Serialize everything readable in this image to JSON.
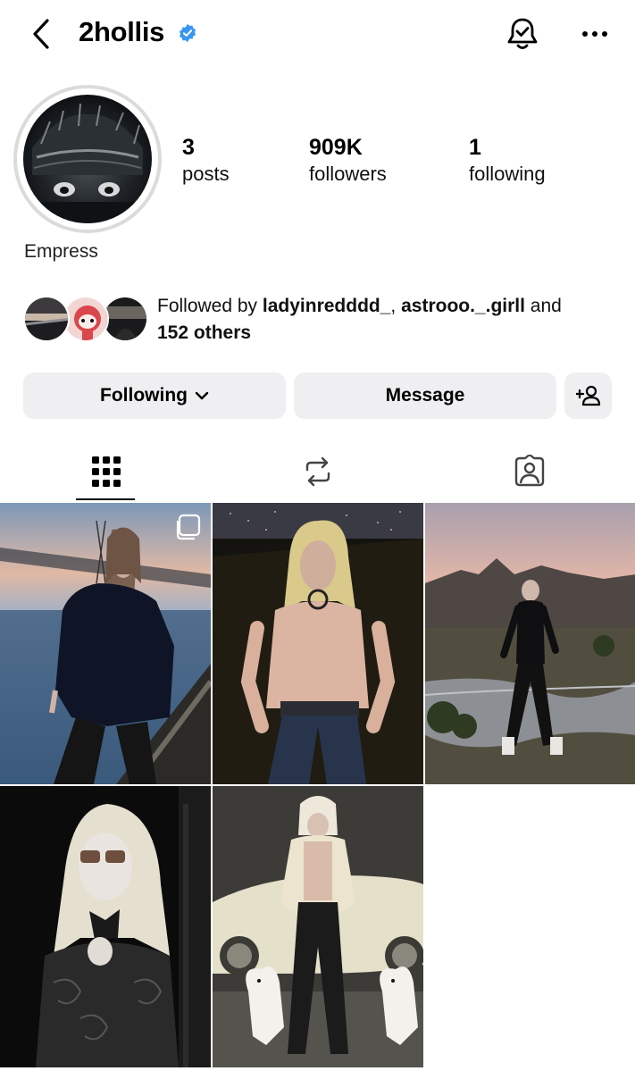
{
  "header": {
    "username": "2hollis"
  },
  "profile": {
    "display_name": "Empress",
    "stats": [
      {
        "value": "3",
        "label": "posts"
      },
      {
        "value": "909K",
        "label": "followers"
      },
      {
        "value": "1",
        "label": "following"
      }
    ],
    "followed_by": {
      "prefix": "Followed by ",
      "users": [
        "ladyinredddd_",
        "astrooo._.girll"
      ],
      "sep": ", ",
      "and": " and",
      "others": "152 others"
    }
  },
  "actions": {
    "following_label": "Following",
    "message_label": "Message"
  },
  "tabs": [
    {
      "icon": "grid-icon",
      "active": true
    },
    {
      "icon": "reels-repost-icon",
      "active": false
    },
    {
      "icon": "tagged-icon",
      "active": false
    }
  ],
  "colors": {
    "verified": "#3897f0",
    "button_bg": "#efeff1",
    "ring": "#dbdbdb"
  }
}
